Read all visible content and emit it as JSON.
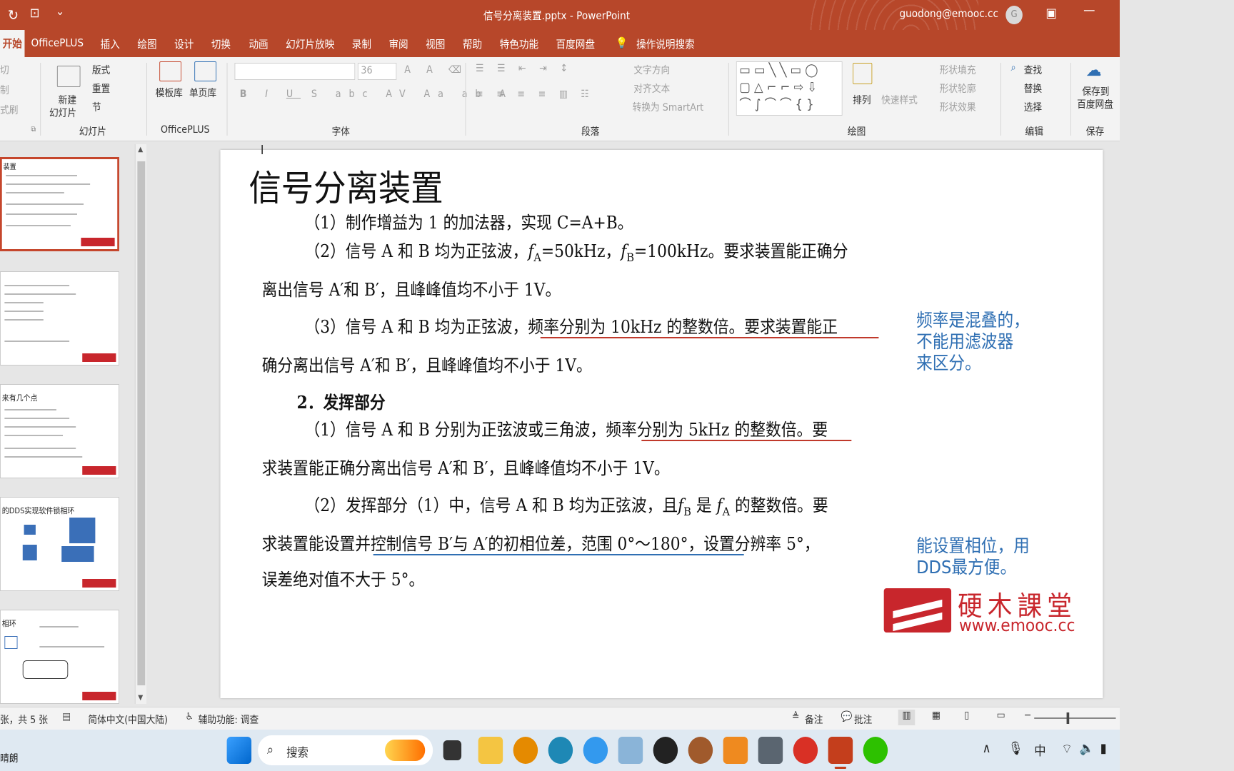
{
  "titlebar": {
    "document_title": "信号分离装置.pptx  -  PowerPoint",
    "account": "guodong@emooc.cc",
    "avatar_letter": "G",
    "qa_dropdown": "⌄"
  },
  "tabs": [
    "开始",
    "OfficePLUS",
    "插入",
    "绘图",
    "设计",
    "切换",
    "动画",
    "幻灯片放映",
    "录制",
    "审阅",
    "视图",
    "帮助",
    "特色功能",
    "百度网盘"
  ],
  "tellme": "操作说明搜索",
  "ribbon": {
    "clipboard": {
      "cut": "剪切",
      "copy": "复制",
      "painter": "格式刷"
    },
    "slides": {
      "new_slide": "新建",
      "new_slide2": "幻灯片",
      "layout": "版式",
      "reset": "重置",
      "section": "节",
      "label": "幻灯片"
    },
    "officeplus": {
      "template": "模板库",
      "single": "单页库",
      "label": "OfficePLUS"
    },
    "font": {
      "size": "36",
      "label": "字体"
    },
    "paragraph": {
      "text_dir": "文字方向",
      "align_text": "对齐文本",
      "smartart": "转换为 SmartArt",
      "label": "段落"
    },
    "drawing": {
      "arrange": "排列",
      "quick_styles": "快速样式",
      "fill": "形状填充",
      "outline": "形状轮廓",
      "effects": "形状效果",
      "label": "绘图"
    },
    "editing": {
      "find": "查找",
      "replace": "替换",
      "select": "选择",
      "label": "编辑"
    },
    "save": {
      "save_to": "保存到",
      "baidu": "百度网盘",
      "label": "保存"
    }
  },
  "thumbnails": [
    {
      "title": "装置"
    },
    {
      "title": ""
    },
    {
      "title": "来有几个点"
    },
    {
      "title": "的DDS实现软件锁相环"
    },
    {
      "title": "相环"
    }
  ],
  "slide": {
    "title": "信号分离装置",
    "p1": "（1）制作增益为 1 的加法器，实现 C=A+B。",
    "p2a": "（2）信号 A 和 B 均为正弦波，",
    "p2_fa": "f",
    "p2_fa_sub": "A",
    "p2_fa_val": "=50kHz，",
    "p2_fb": "f",
    "p2_fb_sub": "B",
    "p2_fb_val": "=100kHz。要求装置能正确分",
    "p2b": "离出信号 A′和 B′，且峰峰值均不小于 1V。",
    "p3a": "（3）信号 A 和 B 均为正弦波，频率分别为 10kHz 的整数倍。要求装置能正",
    "p3b": "确分离出信号 A′和 B′，且峰峰值均不小于 1V。",
    "h2": "2．发挥部分",
    "p4a": "（1）信号 A 和 B 分别为正弦波或三角波，频率分别为 5kHz 的整数倍。要",
    "p4b": "求装置能正确分离出信号 A′和 B′，且峰峰值均不小于 1V。",
    "p5a_1": "（2）发挥部分（1）中，信号 A 和 B 均为正弦波，且",
    "p5a_fb": "f",
    "p5a_fb_sub": "B",
    "p5a_2": " 是 ",
    "p5a_fa": "f",
    "p5a_fa_sub": "A",
    "p5a_3": " 的整数倍。要",
    "p5b": "求装置能设置并控制信号 B′与 A′的初相位差，范围 0°～180°，设置分辨率 5°，",
    "p5c": "误差绝对值不大于 5°。",
    "note1": [
      "频率是混叠的，",
      "不能用滤波器",
      "来区分。"
    ],
    "note2": [
      "能设置相位，用",
      "DDS最方便。"
    ],
    "logo_cn": "硬木課堂",
    "logo_url": "www.emooc.cc"
  },
  "status": {
    "slide_info": "张，共 5 张",
    "lang": "简体中文(中国大陆)",
    "accessibility": "辅助功能: 调查",
    "notes": "备注",
    "comments": "批注"
  },
  "taskbar": {
    "weather": "晴朗",
    "search": "搜索",
    "ime": "中"
  },
  "colors": {
    "accent": "#b7472a",
    "note": "#2f6fb3",
    "underline_red": "#c0392b",
    "underline_blue": "#2f6fb3",
    "logo": "#c8262c"
  }
}
